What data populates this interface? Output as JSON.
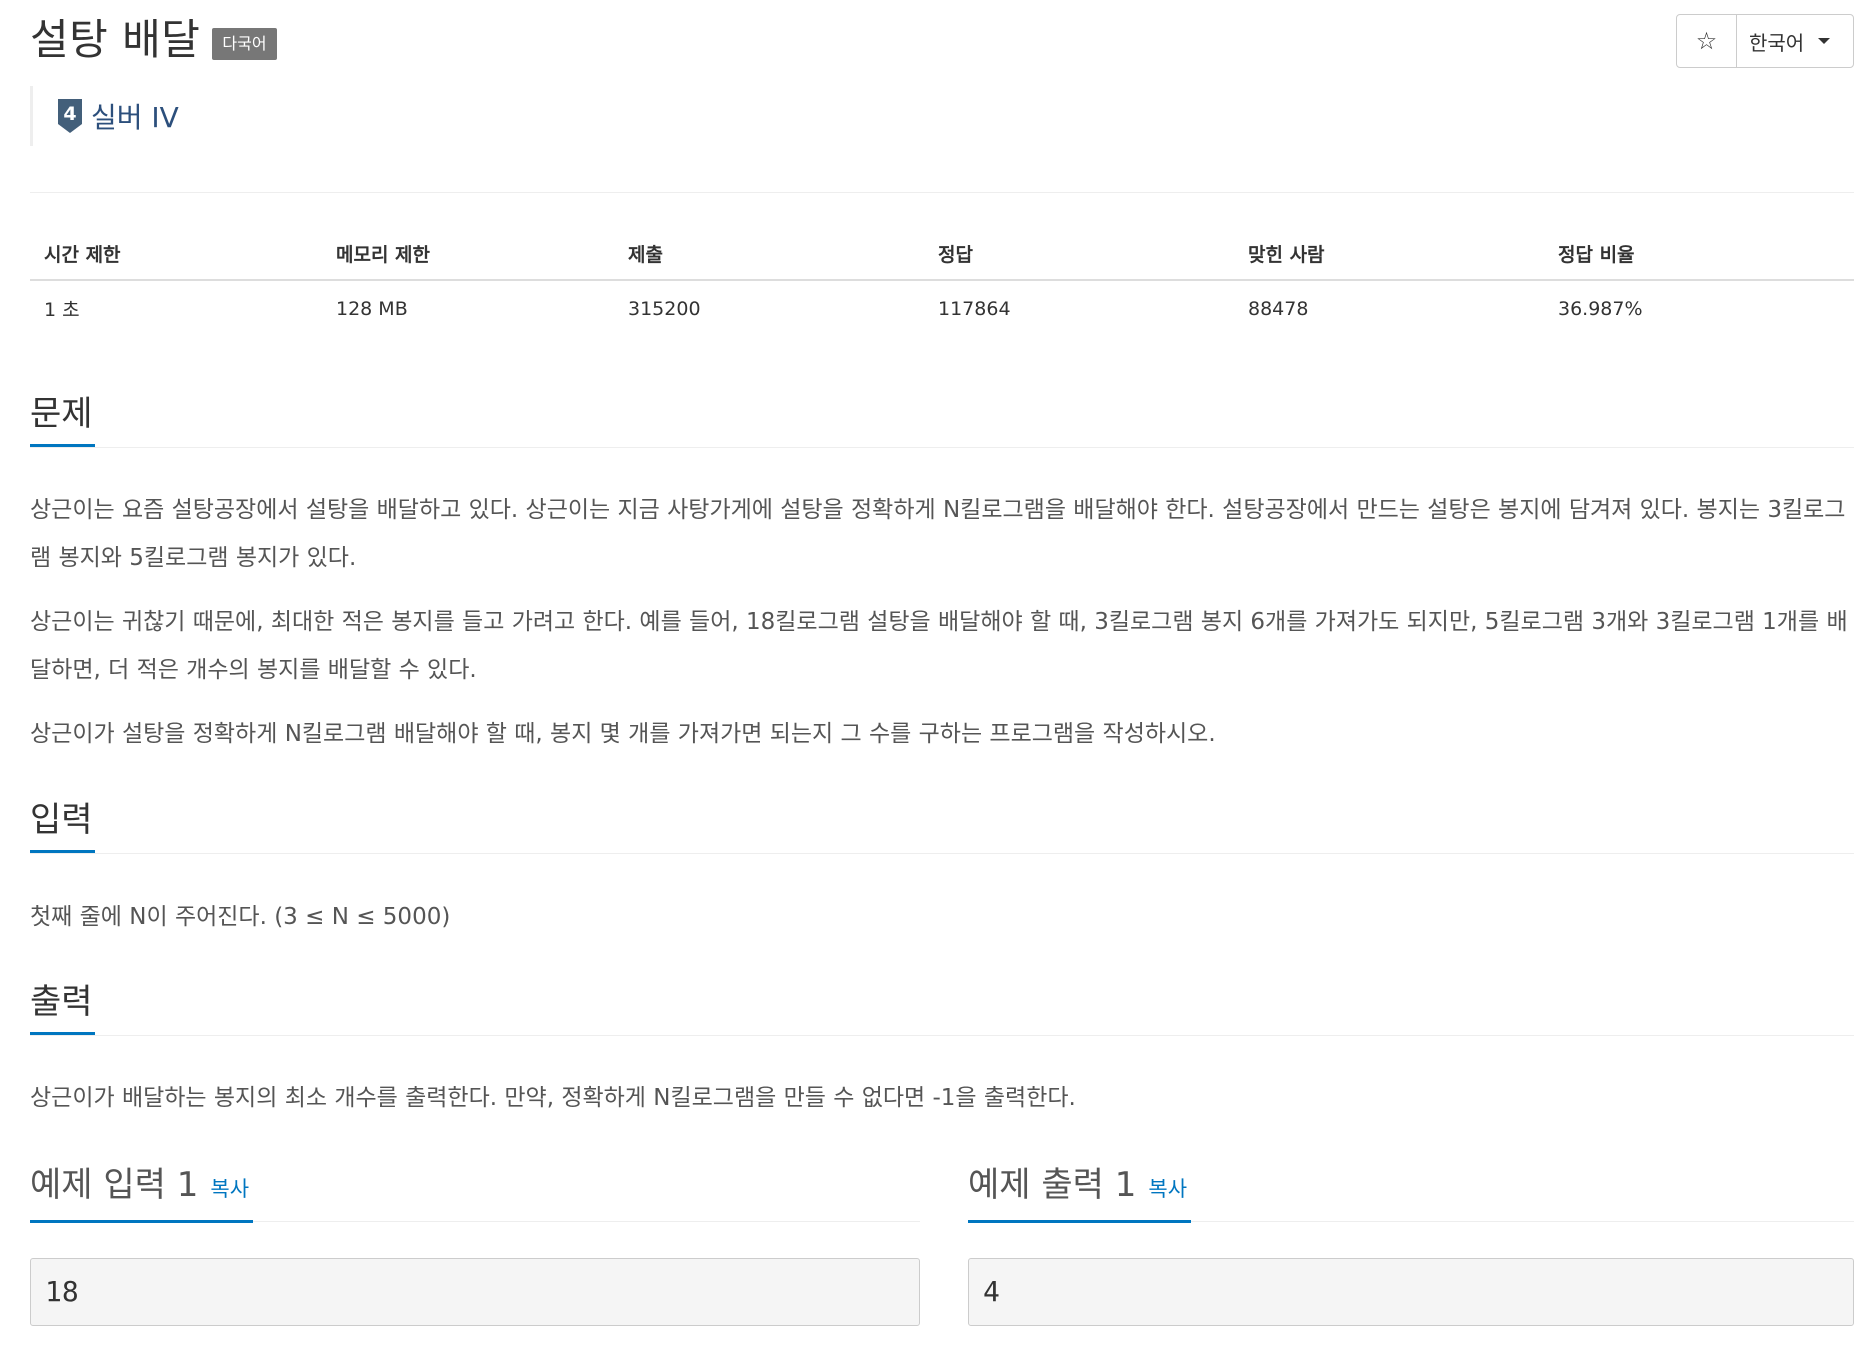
{
  "problem": {
    "title": "설탕 배달",
    "multilang_badge": "다국어",
    "tier_number": "4",
    "tier_label": "실버 IV"
  },
  "controls": {
    "star_icon": "star-outline-icon",
    "star_glyph": "☆",
    "language": "한국어"
  },
  "info_table": {
    "headers": [
      "시간 제한",
      "메모리 제한",
      "제출",
      "정답",
      "맞힌 사람",
      "정답 비율"
    ],
    "values": [
      "1 초",
      "128 MB",
      "315200",
      "117864",
      "88478",
      "36.987%"
    ]
  },
  "sections": {
    "description": {
      "heading": "문제",
      "paragraphs": [
        "상근이는 요즘 설탕공장에서 설탕을 배달하고 있다. 상근이는 지금 사탕가게에 설탕을 정확하게 N킬로그램을 배달해야 한다. 설탕공장에서 만드는 설탕은 봉지에 담겨져 있다. 봉지는 3킬로그램 봉지와 5킬로그램 봉지가 있다.",
        "상근이는 귀찮기 때문에, 최대한 적은 봉지를 들고 가려고 한다. 예를 들어, 18킬로그램 설탕을 배달해야 할 때, 3킬로그램 봉지 6개를 가져가도 되지만, 5킬로그램 3개와 3킬로그램 1개를 배달하면, 더 적은 개수의 봉지를 배달할 수 있다.",
        "상근이가 설탕을 정확하게 N킬로그램 배달해야 할 때, 봉지 몇 개를 가져가면 되는지 그 수를 구하는 프로그램을 작성하시오."
      ]
    },
    "input": {
      "heading": "입력",
      "text": "첫째 줄에 N이 주어진다. (3 ≤ N ≤ 5000)"
    },
    "output": {
      "heading": "출력",
      "text": "상근이가 배달하는 봉지의 최소 개수를 출력한다. 만약, 정확하게 N킬로그램을 만들 수 없다면 -1을 출력한다."
    }
  },
  "samples": {
    "input_heading": "예제 입력 1",
    "output_heading": "예제 출력 1",
    "copy_label": "복사",
    "input_value": "18",
    "output_value": "4"
  },
  "colors": {
    "accent": "#0076c0",
    "tier_silver": "#435f7a",
    "badge_bg": "#777777"
  }
}
